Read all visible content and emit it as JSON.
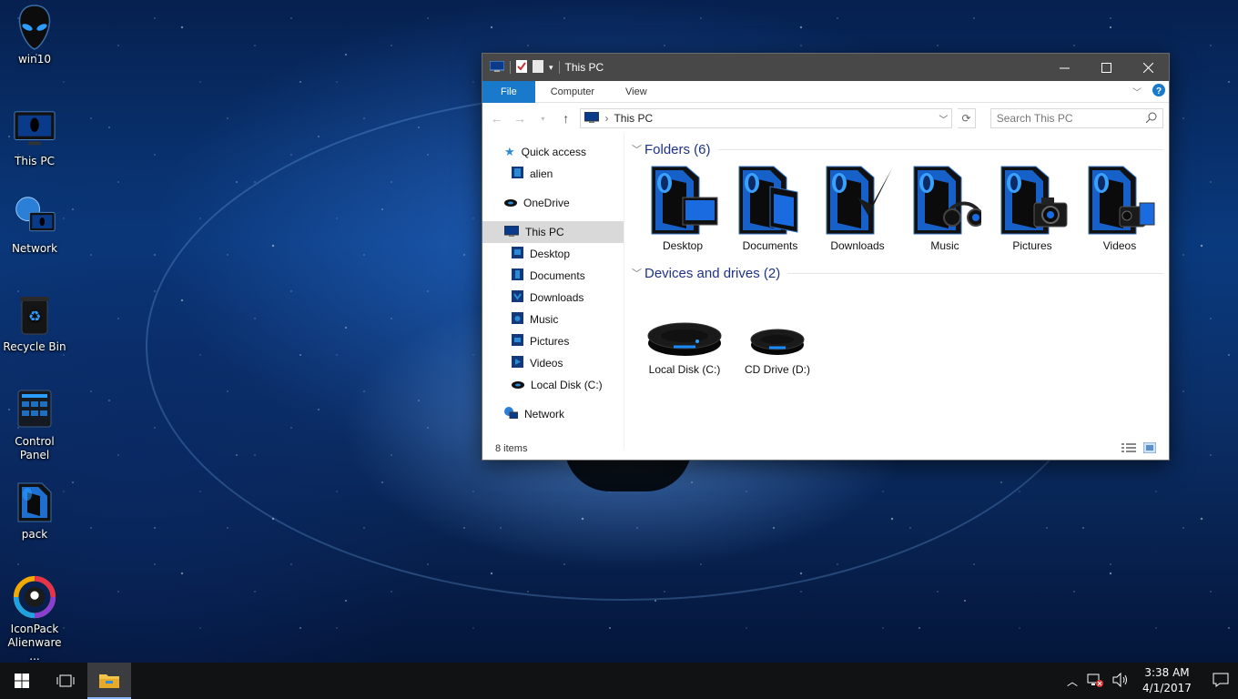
{
  "desktop": {
    "icons": [
      {
        "label": "win10",
        "icon": "alien-head-icon"
      },
      {
        "label": "This PC",
        "icon": "this-pc-icon"
      },
      {
        "label": "Network",
        "icon": "network-icon"
      },
      {
        "label": "Recycle Bin",
        "icon": "recycle-bin-icon"
      },
      {
        "label": "Control Panel",
        "icon": "control-panel-icon"
      },
      {
        "label": "pack",
        "icon": "folder-icon"
      },
      {
        "label": "IconPack Alienware ...",
        "icon": "iconpack-icon"
      }
    ]
  },
  "window": {
    "title": "This PC",
    "ribbon": {
      "file": "File",
      "computer": "Computer",
      "view": "View"
    },
    "address": "This PC",
    "search_placeholder": "Search This PC",
    "nav": {
      "quick_access": "Quick access",
      "alien": "alien",
      "onedrive": "OneDrive",
      "this_pc": "This PC",
      "children": [
        "Desktop",
        "Documents",
        "Downloads",
        "Music",
        "Pictures",
        "Videos",
        "Local Disk (C:)"
      ],
      "network": "Network"
    },
    "folders_heading": "Folders (6)",
    "folders": [
      "Desktop",
      "Documents",
      "Downloads",
      "Music",
      "Pictures",
      "Videos"
    ],
    "drives_heading": "Devices and drives (2)",
    "drives": [
      "Local Disk (C:)",
      "CD Drive (D:)"
    ],
    "status": "8 items"
  },
  "taskbar": {
    "time": "3:38 AM",
    "date": "4/1/2017"
  },
  "colors": {
    "accent": "#1979ca",
    "titlebar": "#484848",
    "heading": "#1e3287",
    "taskbar": "#101214"
  }
}
